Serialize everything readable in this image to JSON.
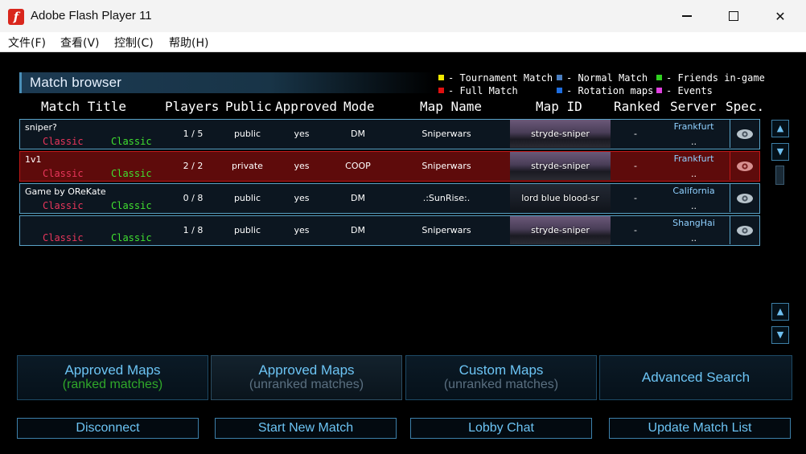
{
  "window": {
    "title": "Adobe Flash Player 11",
    "app_icon_glyph": "f",
    "minimize_glyph": "",
    "close_glyph": "✕"
  },
  "menu": [
    "文件(F)",
    "查看(V)",
    "控制(C)",
    "帮助(H)"
  ],
  "browser": {
    "title": "Match browser"
  },
  "legend": [
    {
      "label": "- Tournament Match",
      "color": "#f0e800"
    },
    {
      "label": "- Normal Match",
      "color": "#4a7ec0"
    },
    {
      "label": "- Friends in-game",
      "color": "#30d020"
    },
    {
      "label": "- Full Match",
      "color": "#e01010"
    },
    {
      "label": "- Rotation maps",
      "color": "#1e6ee0"
    },
    {
      "label": "- Events",
      "color": "#e040e0"
    }
  ],
  "columns": [
    "Match Title",
    "Players",
    "Public",
    "Approved",
    "Mode",
    "Map Name",
    "Map ID",
    "Ranked",
    "Server",
    "Spec."
  ],
  "matches": [
    {
      "title": "sniper?",
      "mode_a": "Classic",
      "mode_b": "Classic",
      "players": "1 / 5",
      "public": "public",
      "approved": "yes",
      "mode": "DM",
      "map_name": "Sniperwars",
      "map_id": "stryde-sniper",
      "ranked": "-",
      "server": "Frankfurt",
      "server_sub": "..",
      "full": false
    },
    {
      "title": "1v1",
      "mode_a": "Classic",
      "mode_b": "Classic",
      "players": "2 / 2",
      "public": "private",
      "approved": "yes",
      "mode": "COOP",
      "map_name": "Sniperwars",
      "map_id": "stryde-sniper",
      "ranked": "-",
      "server": "Frankfurt",
      "server_sub": "..",
      "full": true
    },
    {
      "title": "Game by OReKate",
      "mode_a": "Classic",
      "mode_b": "Classic",
      "players": "0 / 8",
      "public": "public",
      "approved": "yes",
      "mode": "DM",
      "map_name": ".:SunRise:.",
      "map_id": "lord blue blood-sr",
      "ranked": "-",
      "server": "California",
      "server_sub": "..",
      "full": false
    },
    {
      "title": "",
      "mode_a": "Classic",
      "mode_b": "Classic",
      "players": "1 / 8",
      "public": "public",
      "approved": "yes",
      "mode": "DM",
      "map_name": "Sniperwars",
      "map_id": "stryde-sniper",
      "ranked": "-",
      "server": "ShangHai",
      "server_sub": "..",
      "full": false
    }
  ],
  "scroll": {
    "up": "▲",
    "down": "▼"
  },
  "tabs": [
    {
      "line1": "Approved Maps",
      "line2": "(ranked matches)",
      "line2_color": "#30a82a"
    },
    {
      "line1": "Approved Maps",
      "line2": "(unranked matches)",
      "line2_color": "#5a6f80"
    },
    {
      "line1": "Custom Maps",
      "line2": "(unranked matches)",
      "line2_color": "#5a6f80"
    },
    {
      "line1": "Advanced Search"
    }
  ],
  "buttons": {
    "disconnect": "Disconnect",
    "start_new_match": "Start New Match",
    "lobby_chat": "Lobby Chat",
    "update_match_list": "Update Match List"
  }
}
